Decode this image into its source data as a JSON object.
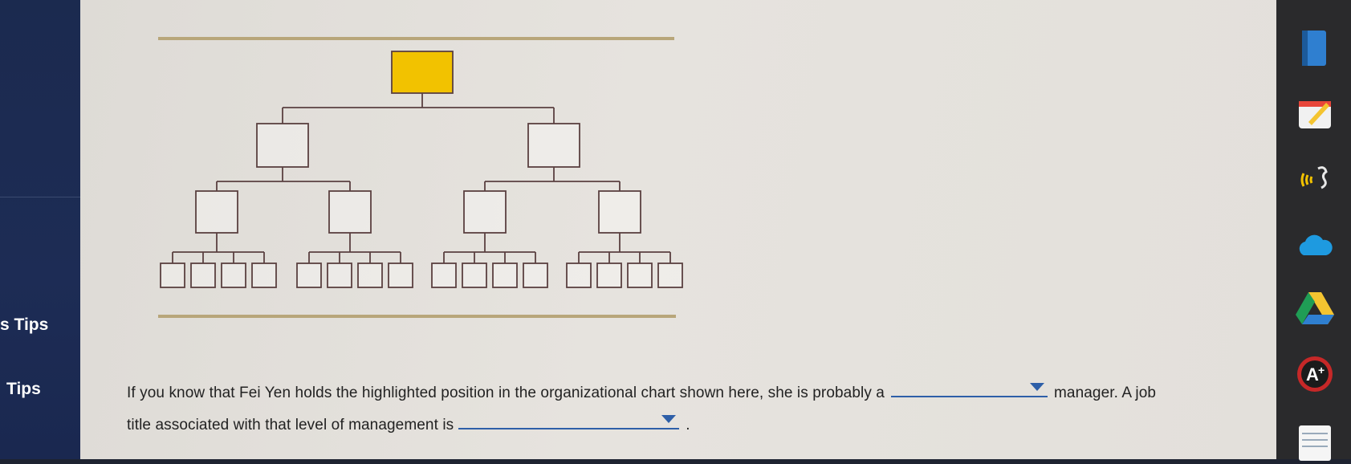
{
  "sidebar": {
    "items": [
      {
        "label": "s Tips"
      },
      {
        "label": "Tips"
      }
    ]
  },
  "question": {
    "part1": "If you know that Fei Yen holds the highlighted position in the organizational chart shown here, she is probably a",
    "part2": "manager. A job",
    "part3": "title associated with that level of management is",
    "part4": ".",
    "dropdown1_value": "",
    "dropdown2_value": ""
  },
  "org_chart": {
    "highlight_color": "#f2c200",
    "line_color": "#5a4040",
    "rule_color": "#b8a67a",
    "highlighted_level": "top"
  },
  "dock": {
    "icons": [
      "book-icon",
      "notepad-icon",
      "speech-icon",
      "cloud-icon",
      "drive-icon",
      "aplus-icon",
      "notes-icon"
    ]
  }
}
